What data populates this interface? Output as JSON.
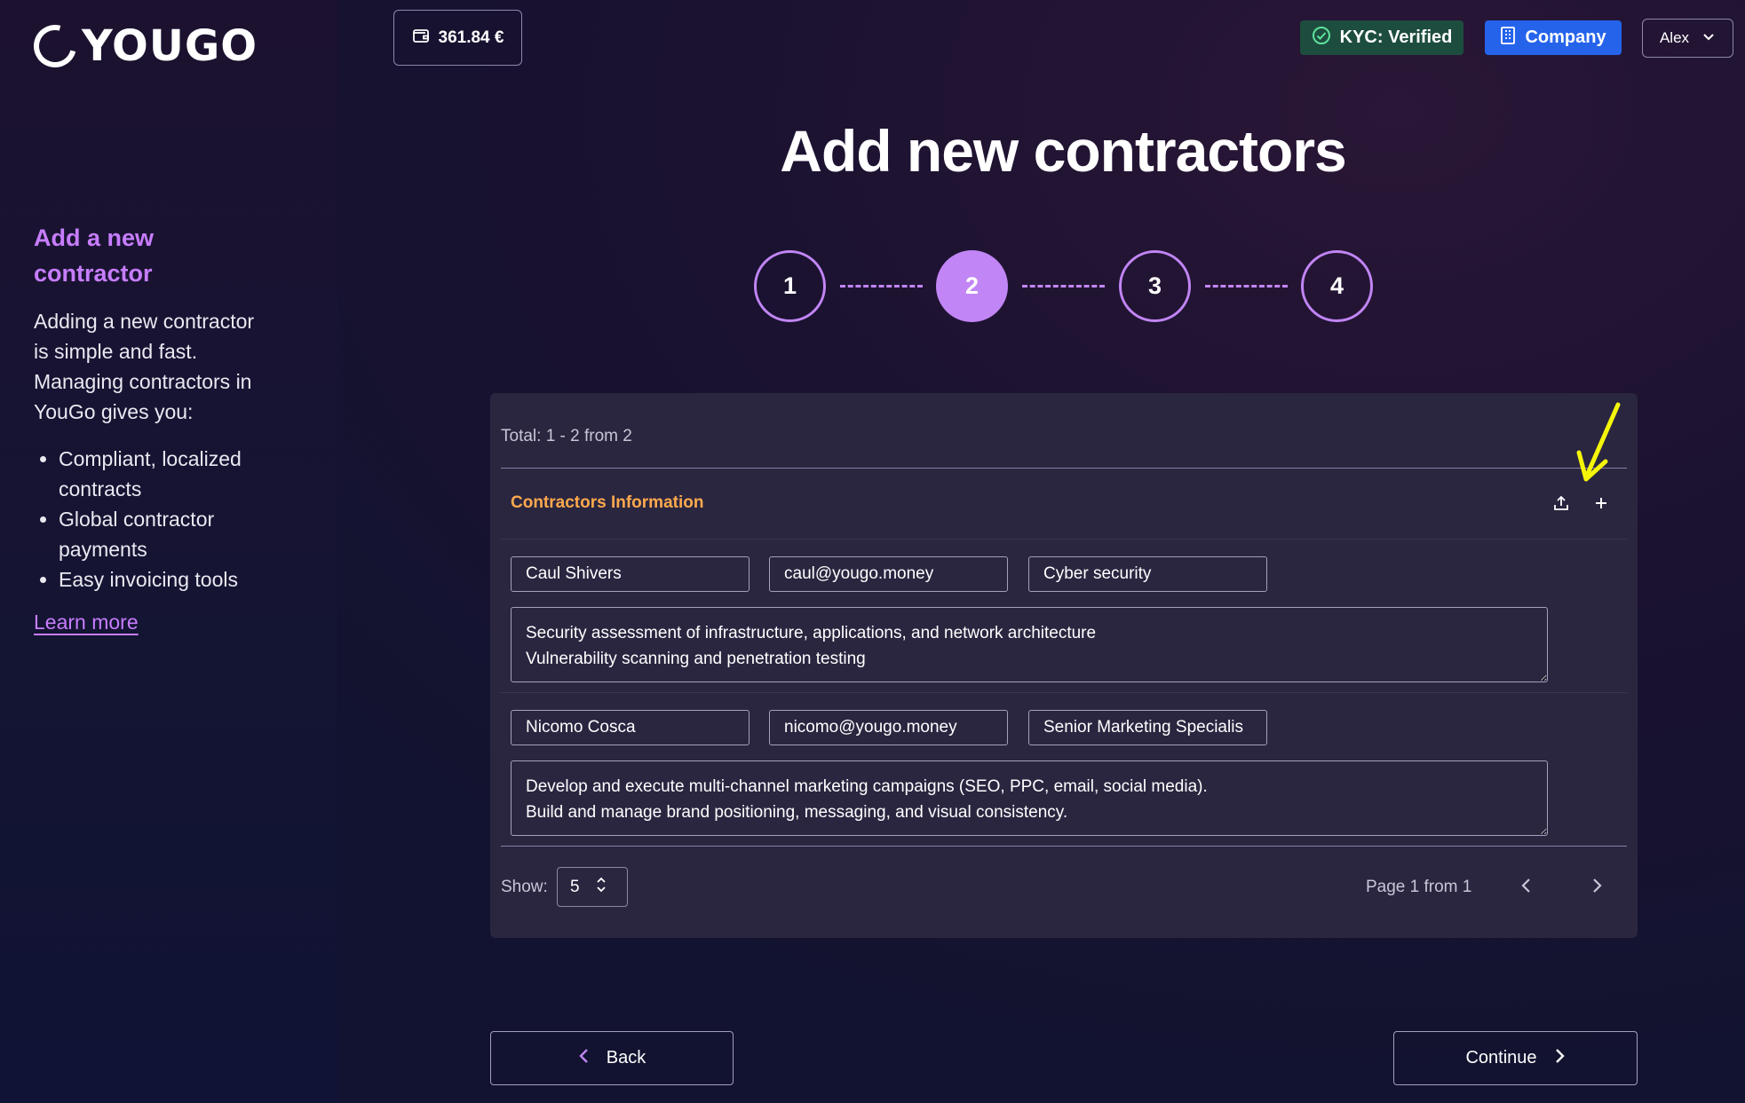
{
  "brand": {
    "name": "YOUGO"
  },
  "header": {
    "balance": "361.84 €",
    "kyc_label": "KYC: Verified",
    "company_label": "Company",
    "user_name": "Alex"
  },
  "sidebar": {
    "title": "Add a new contractor",
    "intro": "Adding a new contractor is simple and fast. Managing contractors in YouGo gives you:",
    "benefits": [
      "Compliant, localized contracts",
      "Global contractor payments",
      "Easy invoicing tools"
    ],
    "learn_more": "Learn more"
  },
  "page": {
    "title": "Add new contractors"
  },
  "stepper": {
    "steps": [
      "1",
      "2",
      "3",
      "4"
    ],
    "current_step": 2
  },
  "table": {
    "total_text": "Total: 1 - 2 from 2",
    "section_title": "Contractors Information",
    "contractors": [
      {
        "name": "Caul Shivers",
        "email": "caul@yougo.money",
        "role": "Cyber security",
        "description": "Security assessment of infrastructure, applications, and network architecture\nVulnerability scanning and penetration testing"
      },
      {
        "name": "Nicomo Cosca",
        "email": "nicomo@yougo.money",
        "role": "Senior Marketing Specialis",
        "description": "Develop and execute multi-channel marketing campaigns (SEO, PPC, email, social media).\nBuild and manage brand positioning, messaging, and visual consistency."
      }
    ],
    "show_label": "Show:",
    "page_size": "5",
    "page_info": "Page 1 from 1"
  },
  "footer": {
    "back_label": "Back",
    "continue_label": "Continue"
  },
  "colors": {
    "accent_purple": "#c185f5",
    "section_orange": "#ffa94d",
    "kyc_green": "#1d4d3e",
    "company_blue": "#2563eb",
    "annotation_arrow": "#f5f50a"
  },
  "icons": [
    "wallet-icon",
    "check-circle-icon",
    "building-icon",
    "chevron-down-icon",
    "upload-icon",
    "plus-icon",
    "updown-icon",
    "chevron-left-icon",
    "chevron-right-icon"
  ]
}
